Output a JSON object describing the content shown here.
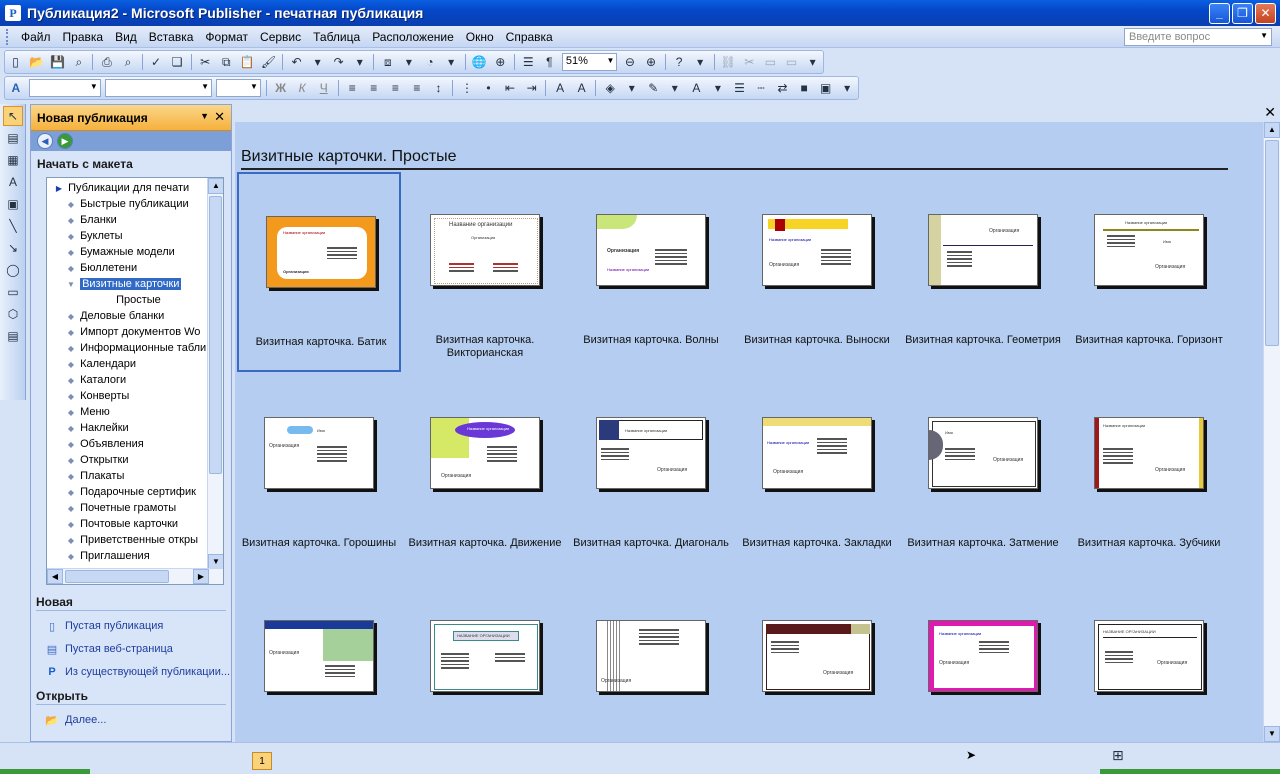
{
  "window": {
    "title": "Публикация2 - Microsoft Publisher - печатная публикация",
    "app_letter": "P"
  },
  "menu": [
    "Файл",
    "Правка",
    "Вид",
    "Вставка",
    "Формат",
    "Сервис",
    "Таблица",
    "Расположение",
    "Окно",
    "Справка"
  ],
  "ask_box": {
    "placeholder": "Введите вопрос"
  },
  "toolbar": {
    "zoom": "51%"
  },
  "task_pane": {
    "title": "Новая публикация",
    "section_start": "Начать с макета",
    "tree": [
      {
        "label": "Публикации для печати",
        "level": 0,
        "bullet": "▶"
      },
      {
        "label": "Быстрые публикации",
        "level": 1,
        "bullet": "◆"
      },
      {
        "label": "Бланки",
        "level": 1,
        "bullet": "◆"
      },
      {
        "label": "Буклеты",
        "level": 1,
        "bullet": "◆"
      },
      {
        "label": "Бумажные модели",
        "level": 1,
        "bullet": "◆"
      },
      {
        "label": "Бюллетени",
        "level": 1,
        "bullet": "◆"
      },
      {
        "label": "Визитные карточки",
        "level": 1,
        "bullet": "▼",
        "selected": true
      },
      {
        "label": "Простые",
        "level": 2,
        "bullet": ""
      },
      {
        "label": "Деловые бланки",
        "level": 1,
        "bullet": "◆"
      },
      {
        "label": "Импорт документов Wo",
        "level": 1,
        "bullet": "◆"
      },
      {
        "label": "Информационные табли",
        "level": 1,
        "bullet": "◆"
      },
      {
        "label": "Календари",
        "level": 1,
        "bullet": "◆"
      },
      {
        "label": "Каталоги",
        "level": 1,
        "bullet": "◆"
      },
      {
        "label": "Конверты",
        "level": 1,
        "bullet": "◆"
      },
      {
        "label": "Меню",
        "level": 1,
        "bullet": "◆"
      },
      {
        "label": "Наклейки",
        "level": 1,
        "bullet": "◆"
      },
      {
        "label": "Объявления",
        "level": 1,
        "bullet": "◆"
      },
      {
        "label": "Открытки",
        "level": 1,
        "bullet": "◆"
      },
      {
        "label": "Плакаты",
        "level": 1,
        "bullet": "◆"
      },
      {
        "label": "Подарочные сертифик",
        "level": 1,
        "bullet": "◆"
      },
      {
        "label": "Почетные грамоты",
        "level": 1,
        "bullet": "◆"
      },
      {
        "label": "Почтовые карточки",
        "level": 1,
        "bullet": "◆"
      },
      {
        "label": "Приветственные откры",
        "level": 1,
        "bullet": "◆"
      },
      {
        "label": "Приглашения",
        "level": 1,
        "bullet": "◆"
      }
    ],
    "section_new": "Новая",
    "new_links": [
      "Пустая публикация",
      "Пустая веб-страница",
      "Из существующей публикации..."
    ],
    "section_open": "Открыть",
    "open_link": "Далее..."
  },
  "catalog": {
    "title": "Визитные карточки. Простые",
    "cards": [
      {
        "label": "Визитная карточка. Батик",
        "selected": true
      },
      {
        "label": "Визитная карточка. Викторианская"
      },
      {
        "label": "Визитная карточка. Волны"
      },
      {
        "label": "Визитная карточка. Выноски"
      },
      {
        "label": "Визитная карточка. Геометрия"
      },
      {
        "label": "Визитная карточка. Горизонт"
      },
      {
        "label": "Визитная карточка. Горошины"
      },
      {
        "label": "Визитная карточка. Движение"
      },
      {
        "label": "Визитная карточка. Диагональ"
      },
      {
        "label": "Визитная карточка. Закладки"
      },
      {
        "label": "Визитная карточка. Затмение"
      },
      {
        "label": "Визитная карточка. Зубчики"
      },
      {
        "label": ""
      },
      {
        "label": ""
      },
      {
        "label": ""
      },
      {
        "label": ""
      },
      {
        "label": ""
      },
      {
        "label": ""
      }
    ],
    "thumb_text": {
      "org": "Организация",
      "org_name": "Название организации",
      "org_upper": "НАЗВАНИЕ ОРГАНИЗАЦИИ",
      "name": "Имя"
    }
  },
  "status": {
    "page": "1"
  },
  "colors": {
    "accent_orange": "#f5b13c",
    "selection": "#316ac5",
    "title_blue": "#0447c8"
  }
}
